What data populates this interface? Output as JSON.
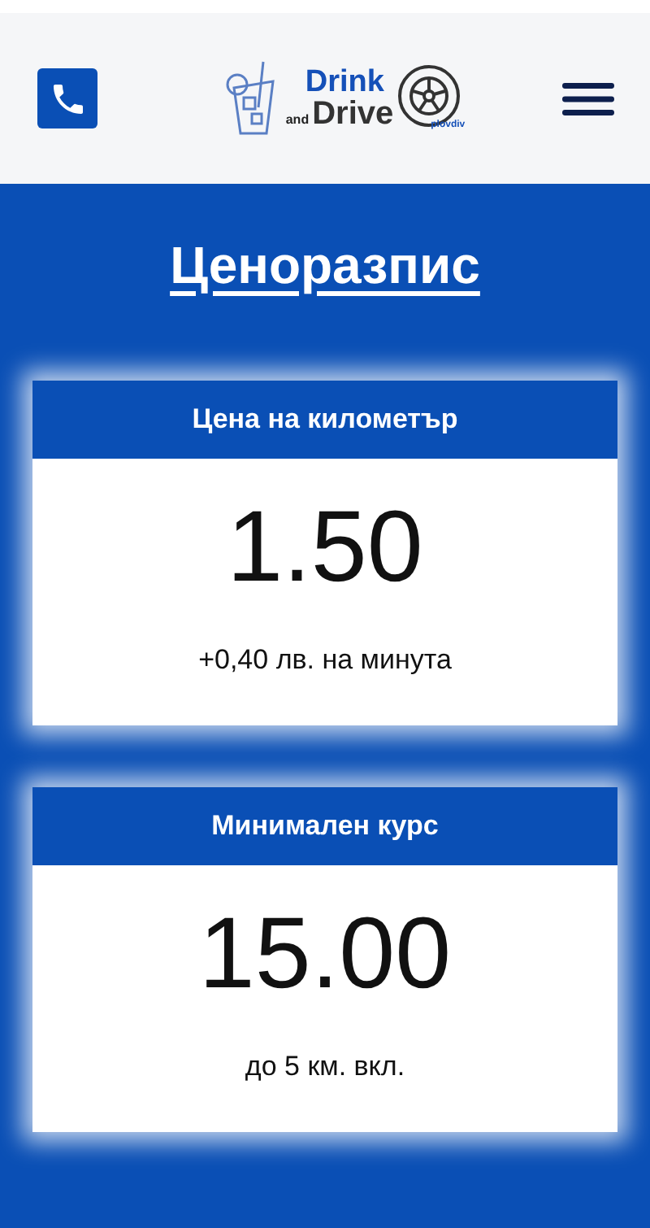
{
  "header": {
    "logo": {
      "word_1": "Drink",
      "word_2": "and",
      "word_3": "Drive",
      "tagline": "plovdiv"
    }
  },
  "title": "Ценоразпис",
  "cards": [
    {
      "heading": "Цена на километър",
      "price": "1.50",
      "note": "+0,40 лв. на минута"
    },
    {
      "heading": "Минимален курс",
      "price": "15.00",
      "note": "до 5 км. вкл."
    }
  ]
}
